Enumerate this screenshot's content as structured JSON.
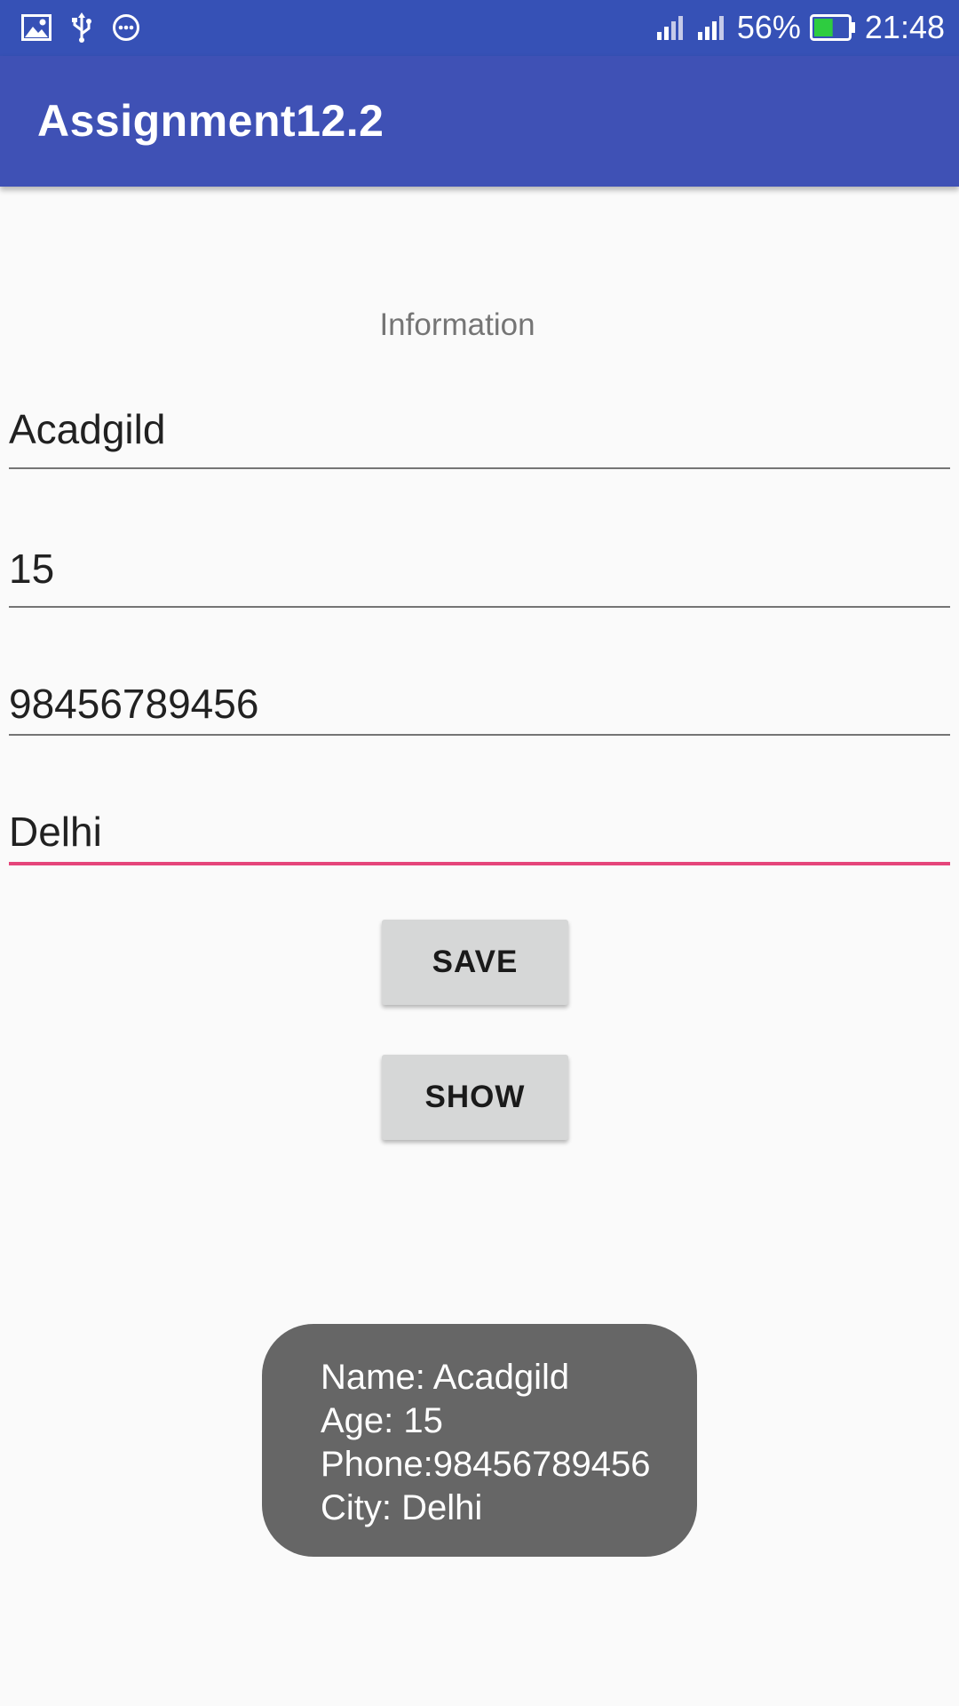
{
  "status_bar": {
    "left_icons": [
      "image-icon",
      "usb-icon",
      "more-icon"
    ],
    "right_icons": [
      "signal-icon",
      "signal-icon",
      "battery-icon"
    ],
    "battery_percent": "56%",
    "battery_level": 0.56,
    "battery_color": "#2ecc40",
    "time": "21:48"
  },
  "app_bar": {
    "title": "Assignment12.2",
    "color": "#3f51b5"
  },
  "form": {
    "heading": "Information",
    "name_value": "Acadgild",
    "age_value": "15",
    "phone_value": "98456789456",
    "city_value": "Delhi",
    "accent_color": "#e5457a"
  },
  "buttons": {
    "save_label": "SAVE",
    "show_label": "SHOW"
  },
  "toast": {
    "lines": [
      "Name: Acadgild",
      "Age: 15",
      "Phone:98456789456",
      "City: Delhi"
    ]
  }
}
